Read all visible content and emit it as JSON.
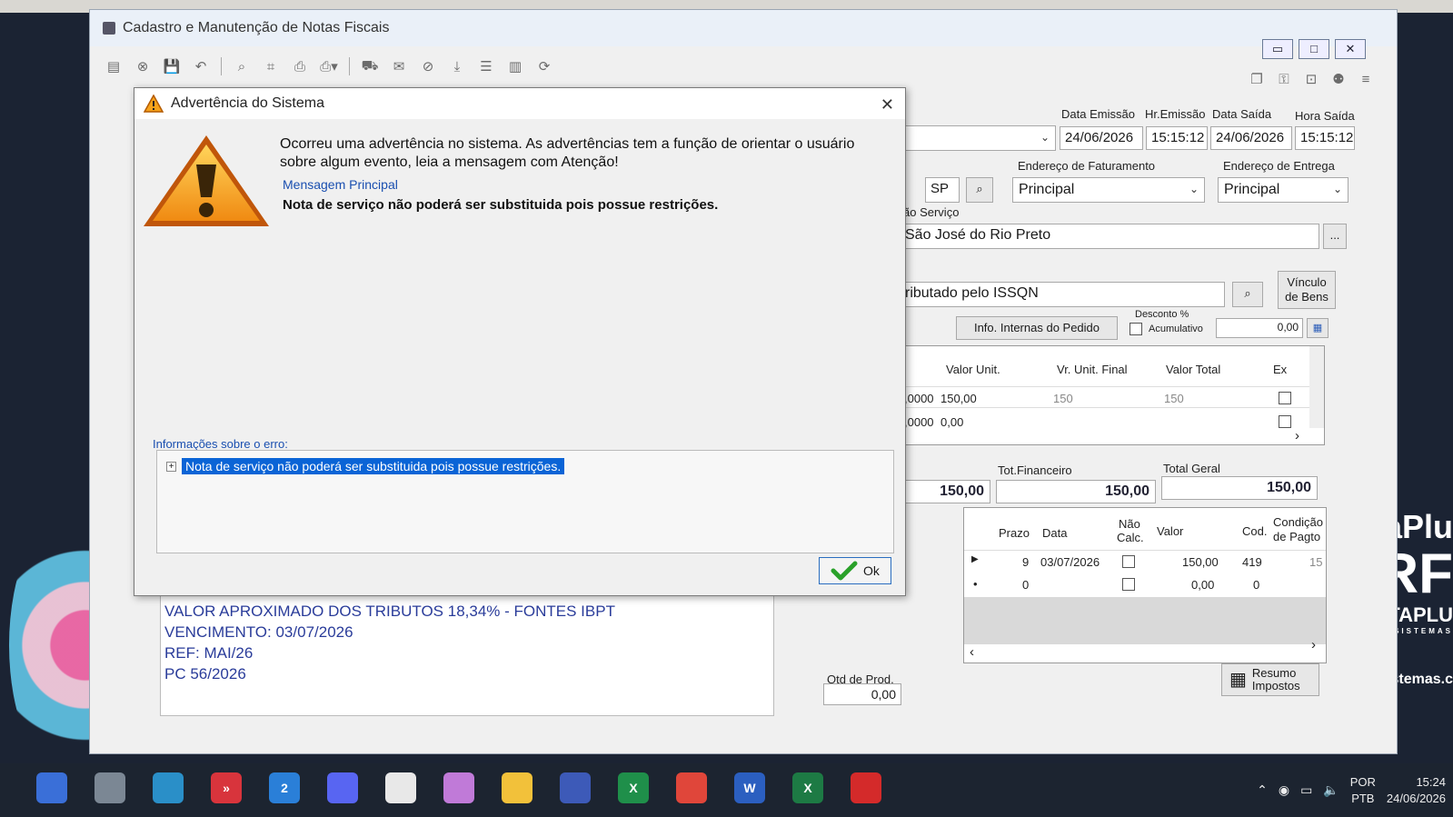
{
  "window": {
    "title": "Cadastro e Manutenção de Notas Fiscais",
    "controls": [
      "▭",
      "□",
      "✕"
    ]
  },
  "header": {
    "data_emissao_label": "Data Emissão",
    "hr_emissao_label": "Hr.Emissão",
    "data_saida_label": "Data Saída",
    "hora_saida_label": "Hora Saída",
    "data_emissao": "24/06/2026",
    "hr_emissao": "15:15:12",
    "data_saida": "24/06/2026",
    "hora_saida": "15:15:12"
  },
  "address": {
    "uf": "SP",
    "faturamento_label": "Endereço de Faturamento",
    "faturamento_value": "Principal",
    "entrega_label": "Endereço de Entrega",
    "entrega_value": "Principal",
    "servico_label": "ão Serviço",
    "cidade": "São José do Rio Preto",
    "lookup_btn": "...",
    "tributacao": "ributado pelo ISSQN",
    "vinculo_line1": "Vínculo",
    "vinculo_line2": "de Bens"
  },
  "pedido": {
    "info_btn": "Info. Internas do Pedido",
    "desconto_label": "Desconto %",
    "acumulativo_label": "Acumulativo",
    "desconto_value": "0,00"
  },
  "items_grid": {
    "headers": [
      "Valor Unit.",
      "Vr. Unit. Final",
      "Valor Total",
      "Ex"
    ],
    "rows": [
      {
        "qtd": ",0000",
        "valor_unit": "150,00",
        "vr_final": "150",
        "valor_total": "150"
      },
      {
        "qtd": ",0000",
        "valor_unit": "0,00",
        "vr_final": "",
        "valor_total": ""
      }
    ],
    "scroll_right": "›"
  },
  "totals": {
    "total_left": "150,00",
    "tot_financeiro_label": "Tot.Financeiro",
    "tot_financeiro": "150,00",
    "total_geral_label": "Total Geral",
    "total_geral": "150,00"
  },
  "payments_grid": {
    "headers": {
      "prazo": "Prazo",
      "data": "Data",
      "nao_calc_1": "Não",
      "nao_calc_2": "Calc.",
      "valor": "Valor",
      "cod": "Cod.",
      "cond_1": "Condição",
      "cond_2": "de Pagto"
    },
    "rows": [
      {
        "marker": "▶",
        "prazo": "9",
        "data": "03/07/2026",
        "valor": "150,00",
        "cod": "419",
        "cond": "15"
      },
      {
        "marker": "•",
        "prazo": "0",
        "data": "",
        "valor": "0,00",
        "cod": "0",
        "cond": ""
      }
    ],
    "scroll_left": "‹",
    "scroll_right": "›"
  },
  "resumo_btn": {
    "line1": "Resumo",
    "line2": "Impostos"
  },
  "notes": {
    "lines": [
      "VALOR APROXIMADO DOS TRIBUTOS 18,34% - FONTES IBPT",
      "VENCIMENTO: 03/07/2026",
      "REF: MAI/26",
      "PC 56/2026"
    ]
  },
  "qtd_prod": {
    "label": "Qtd de Prod.",
    "value": "0,00"
  },
  "dialog": {
    "title": "Advertência do Sistema",
    "message": "Ocorreu uma advertência no sistema. As advertências tem a função de orientar o usuário sobre algum evento, leia a mensagem com Atenção!",
    "sub_label": "Mensagem Principal",
    "main_message": "Nota de serviço não poderá ser substituida pois possue restrições.",
    "info_label": "Informações sobre o erro:",
    "tree_item": "Nota de serviço não poderá ser substituida pois possue restrições.",
    "ok_label": "Ok",
    "close": "✕"
  },
  "brand": {
    "line1": "aPlu",
    "line2": "RF",
    "line3": "TAPLU",
    "line4": "SISTEMAS",
    "line5": "istemas.c"
  },
  "taskbar": {
    "icons": [
      "",
      "",
      "",
      "»",
      "2",
      "",
      "",
      "",
      "",
      "",
      "X",
      "",
      "W",
      "X",
      ""
    ],
    "lang_1": "POR",
    "lang_2": "PTB",
    "time": "15:24",
    "date": "24/06/2026"
  },
  "colors": {
    "accent": "#0a64d6",
    "link": "#1a4fb0",
    "notes_text": "#2a3c9a"
  }
}
